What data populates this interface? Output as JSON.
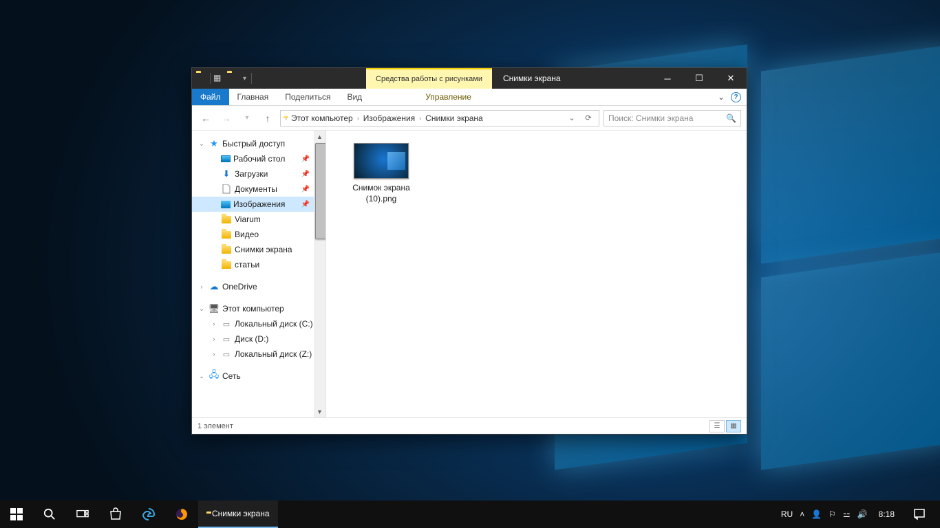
{
  "titlebar": {
    "context_tab": "Средства работы с рисунками",
    "title": "Снимки экрана"
  },
  "ribbon": {
    "file": "Файл",
    "home": "Главная",
    "share": "Поделиться",
    "view": "Вид",
    "manage": "Управление"
  },
  "address": {
    "seg1": "Этот компьютер",
    "seg2": "Изображения",
    "seg3": "Снимки экрана"
  },
  "search": {
    "placeholder": "Поиск: Снимки экрана"
  },
  "tree": {
    "quick_access": "Быстрый доступ",
    "desktop": "Рабочий стол",
    "downloads": "Загрузки",
    "documents": "Документы",
    "pictures": "Изображения",
    "viarum": "Viarum",
    "video": "Видео",
    "screenshots": "Снимки экрана",
    "articles": "статьи",
    "onedrive": "OneDrive",
    "this_pc": "Этот компьютер",
    "disk_c": "Локальный диск (C:)",
    "disk_d": "Диск (D:)",
    "disk_z": "Локальный диск (Z:)",
    "network": "Сеть"
  },
  "file": {
    "name_l1": "Снимок экрана",
    "name_l2": "(10).png"
  },
  "status": {
    "text": "1 элемент"
  },
  "taskbar": {
    "app": "Снимки экрана",
    "lang": "RU",
    "time": "8:18"
  }
}
